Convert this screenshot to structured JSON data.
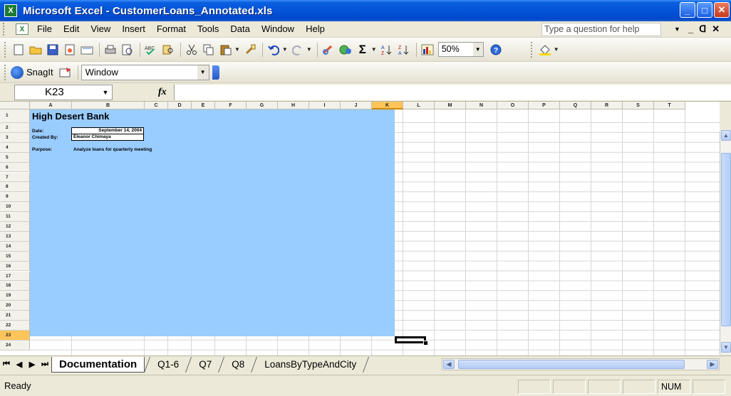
{
  "window": {
    "app_icon_glyph": "X",
    "title": "Microsoft Excel - CustomerLoans_Annotated.xls",
    "minimize": "_",
    "maximize": "□",
    "close": "✕"
  },
  "menubar": {
    "items": [
      "File",
      "Edit",
      "View",
      "Insert",
      "Format",
      "Tools",
      "Data",
      "Window",
      "Help"
    ],
    "help_placeholder": "Type a question for help",
    "mdi_min": "_",
    "mdi_restore": "ᗡ",
    "mdi_close": "✕"
  },
  "toolbar": {
    "zoom": "50%"
  },
  "snagit": {
    "label": "SnagIt",
    "window_select": "Window"
  },
  "formula": {
    "name_box": "K23",
    "fx": "fx"
  },
  "columns": [
    "A",
    "B",
    "C",
    "D",
    "E",
    "F",
    "G",
    "H",
    "I",
    "J",
    "K",
    "L",
    "M",
    "N",
    "O",
    "P",
    "Q",
    "R",
    "S",
    "T"
  ],
  "selected_column": "K",
  "rows": [
    "1",
    "2",
    "3",
    "4",
    "5",
    "6",
    "7",
    "8",
    "9",
    "10",
    "11",
    "12",
    "13",
    "14",
    "15",
    "16",
    "17",
    "18",
    "19",
    "20",
    "21",
    "22",
    "23",
    "24"
  ],
  "selected_row": "23",
  "sheet": {
    "title": "High Desert Bank",
    "date_label": "Date:",
    "date_value": "September 14, 2004",
    "created_label": "Created By:",
    "created_value": "Eleanor Chimaya",
    "purpose_label": "Purpose:",
    "purpose_value": "Analyze loans for quarterly meeting",
    "fill_color": "#99ccff"
  },
  "tabs": {
    "nav_first": "⏮",
    "nav_prev": "◀",
    "nav_next": "▶",
    "nav_last": "⏭",
    "items": [
      "Documentation",
      "Q1-6",
      "Q7",
      "Q8",
      "LoansByTypeAndCity"
    ],
    "active": "Documentation"
  },
  "status": {
    "text": "Ready",
    "num": "NUM"
  }
}
